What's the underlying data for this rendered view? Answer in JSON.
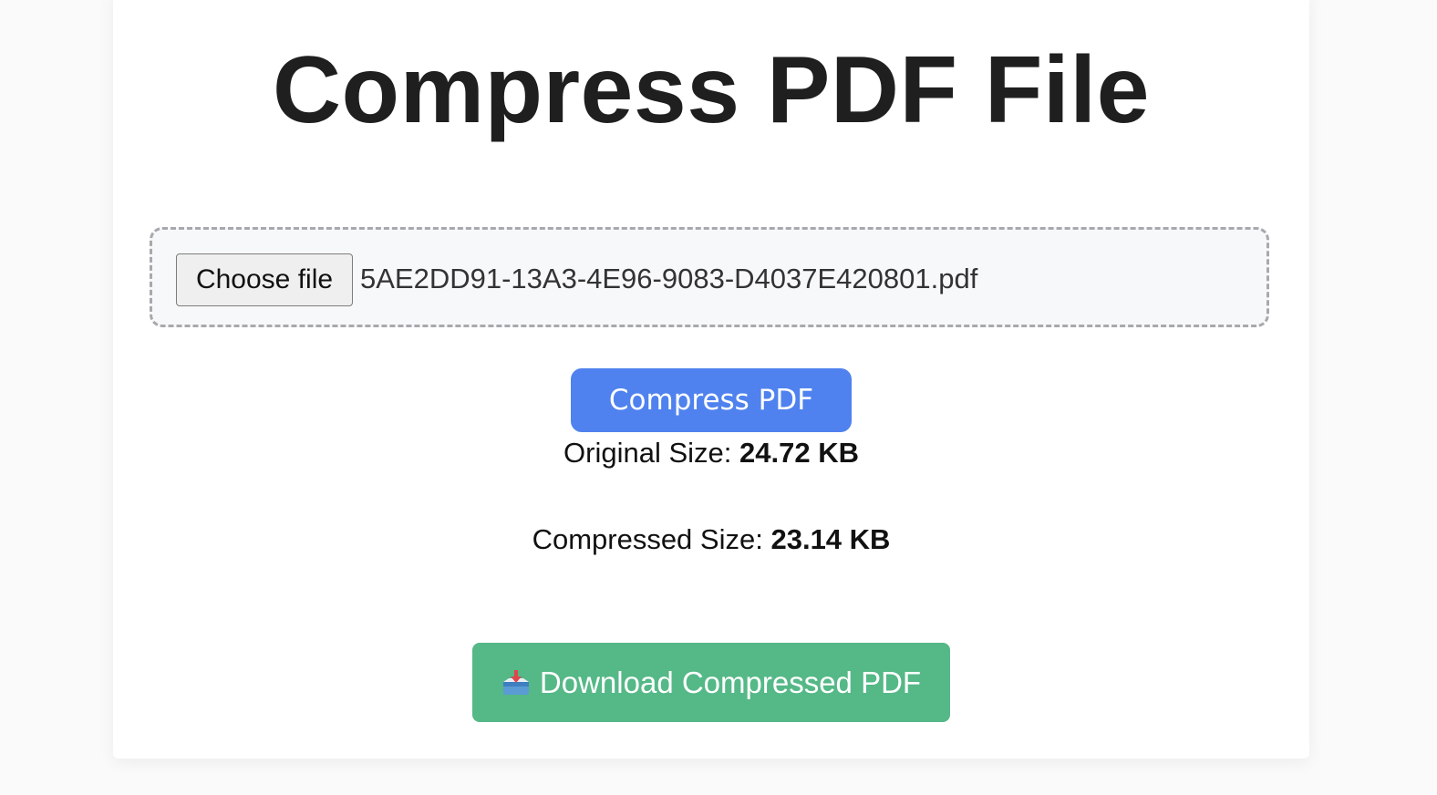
{
  "page": {
    "title": "Compress PDF File"
  },
  "upload": {
    "choose_label": "Choose file",
    "file_name": "5AE2DD91-13A3-4E96-9083-D4037E420801.pdf"
  },
  "actions": {
    "compress_label": "Compress PDF",
    "download_label": "Download Compressed PDF",
    "download_icon": "inbox-tray-icon"
  },
  "results": {
    "original_label": "Original Size:",
    "original_value": "24.72 KB",
    "compressed_label": "Compressed Size:",
    "compressed_value": "23.14 KB"
  },
  "colors": {
    "compress_button": "#4f82ee",
    "download_button": "#55b887",
    "dropzone_border": "#a8a8ad"
  }
}
